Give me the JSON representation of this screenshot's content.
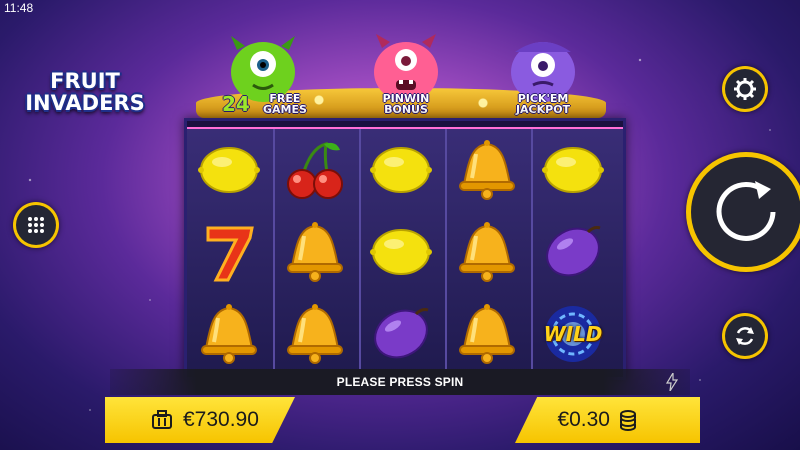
{
  "status": {
    "time": "11:48"
  },
  "logo": {
    "line1": "FRUIT",
    "line2": "INVADERS"
  },
  "features": [
    {
      "big": "24",
      "top": "FREE",
      "bottom": "GAMES",
      "color": "#6ed11e"
    },
    {
      "top": "PINWIN",
      "bottom": "BONUS",
      "color": "#ff5f93"
    },
    {
      "top": "PICK'EM",
      "bottom": "JACKPOT",
      "color": "#8a5be0"
    }
  ],
  "reels": [
    [
      "lemon",
      "seven",
      "bell"
    ],
    [
      "cherry",
      "bell",
      "bell"
    ],
    [
      "lemon",
      "lemon",
      "plum"
    ],
    [
      "bell",
      "bell",
      "bell"
    ],
    [
      "lemon",
      "plum",
      "wild"
    ]
  ],
  "wild_text": "WILD",
  "message": "PLEASE PRESS SPIN",
  "balance": {
    "value": "€730.90",
    "icon": "wallet-icon"
  },
  "bet": {
    "value": "€0.30",
    "icon": "coins-icon"
  },
  "icons": {
    "menu": "grid-icon",
    "settings": "gear-icon",
    "spin": "spin-arrow-icon",
    "autoplay": "autoplay-icon",
    "turbo": "lightning-icon"
  },
  "colors": {
    "accent": "#f6c400",
    "button_dark": "#242634",
    "frame": "#2a2070"
  }
}
